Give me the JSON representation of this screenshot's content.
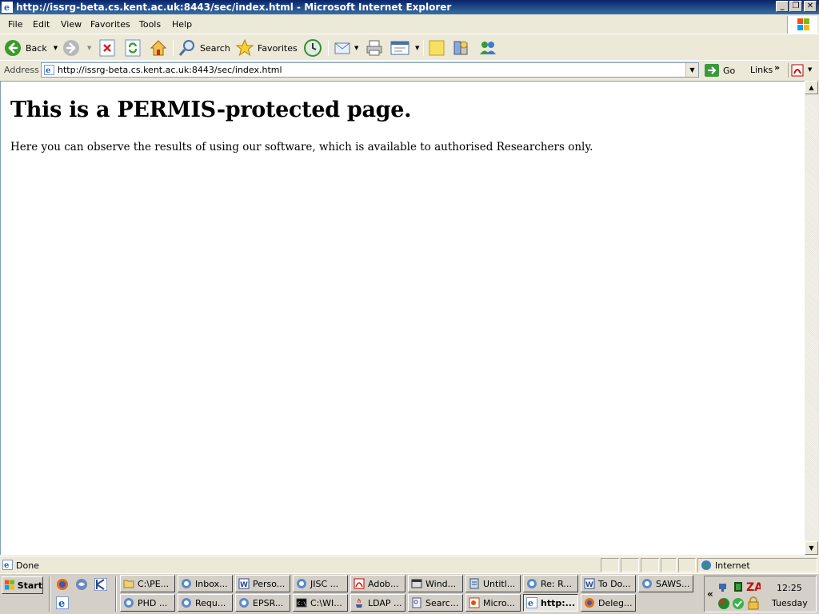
{
  "window": {
    "title": "http://issrg-beta.cs.kent.ac.uk:8443/sec/index.html - Microsoft Internet Explorer"
  },
  "menu": [
    "File",
    "Edit",
    "View",
    "Favorites",
    "Tools",
    "Help"
  ],
  "toolbar": {
    "back_label": "Back",
    "search_label": "Search",
    "favorites_label": "Favorites"
  },
  "address": {
    "label": "Address",
    "url": "http://issrg-beta.cs.kent.ac.uk:8443/sec/index.html",
    "go_label": "Go",
    "links_label": "Links"
  },
  "page": {
    "heading": "This is a PERMIS-protected page.",
    "paragraph": "Here you can observe the results of using our software, which is available to authorised Researchers only."
  },
  "status": {
    "text": "Done",
    "zone": "Internet"
  },
  "taskbar": {
    "start_label": "Start",
    "row1": [
      {
        "label": "C:\\PE...",
        "icon": "folder-icon"
      },
      {
        "label": "Inbox...",
        "icon": "ie-icon"
      },
      {
        "label": "Perso...",
        "icon": "word-icon"
      },
      {
        "label": "JISC ...",
        "icon": "ie-icon"
      },
      {
        "label": "Adob...",
        "icon": "acrobat-icon"
      },
      {
        "label": "Wind...",
        "icon": "window-icon"
      },
      {
        "label": "Untitl...",
        "icon": "notepad-icon"
      },
      {
        "label": "Re: R...",
        "icon": "ie-icon"
      },
      {
        "label": "To Do...",
        "icon": "word-icon"
      },
      {
        "label": "SAWS...",
        "icon": "ie-icon"
      }
    ],
    "row2": [
      {
        "label": "PHD ...",
        "icon": "ie-icon"
      },
      {
        "label": "Requ...",
        "icon": "ie-icon"
      },
      {
        "label": "EPSR...",
        "icon": "ie-icon"
      },
      {
        "label": "C:\\WI...",
        "icon": "console-icon"
      },
      {
        "label": "LDAP ...",
        "icon": "java-icon"
      },
      {
        "label": "Searc...",
        "icon": "search-doc-icon"
      },
      {
        "label": "Micro...",
        "icon": "powerpoint-icon"
      },
      {
        "label": "http:...",
        "icon": "ie-page-icon"
      },
      {
        "label": "Deleg...",
        "icon": "firefox-icon"
      }
    ],
    "clock": "12:25",
    "day": "Tuesday"
  }
}
